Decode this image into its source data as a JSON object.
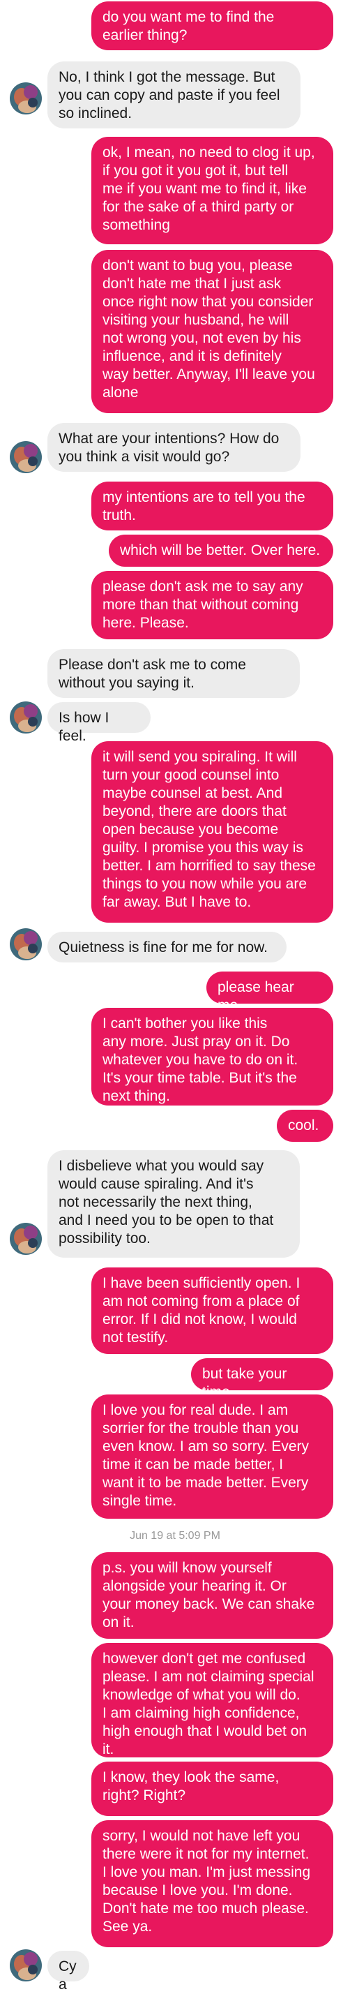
{
  "colors": {
    "sent_bubble": "#e8175d",
    "received_bubble": "#ececec",
    "timestamp_text": "#999999"
  },
  "messages": [
    {
      "text": "do you want me to find the\nearlier thing?"
    },
    {
      "text": "No, I think I got the message. But\nyou can copy and paste if you feel\nso inclined."
    },
    {
      "text": "ok, I mean, no need to clog it up,\nif you got it you got it, but tell\nme if you want me to find it, like\nfor the sake of a third party or\nsomething"
    },
    {
      "text": "don't want to bug you, please\ndon't hate me that I just ask\nonce right now that you consider\nvisiting your husband, he will\nnot wrong you, not even by his\ninfluence, and it is definitely\nway better. Anyway, I'll leave you\nalone"
    },
    {
      "text": "What are your intentions? How do\nyou think a visit would go?"
    },
    {
      "text": "my intentions are to tell you the\ntruth."
    },
    {
      "text": "which will be better. Over here."
    },
    {
      "text": "please don't ask me to say any\nmore than that without coming\nhere. Please."
    },
    {
      "text": "Please don't ask me to come\nwithout you saying it."
    },
    {
      "text": "Is how I feel."
    },
    {
      "text": "it will send you spiraling. It will\nturn your good counsel into\nmaybe counsel at best. And\nbeyond, there are doors that\nopen because you become\nguilty. I promise you this way is\nbetter. I am horrified to say these\nthings to you now while you are\nfar away. But I have to."
    },
    {
      "text": "Quietness is fine for me for now."
    },
    {
      "text": "please hear me."
    },
    {
      "text": "I can't bother you like this\nany more. Just pray on it. Do\nwhatever you have to do on it.\nIt's your time table. But it's the\nnext thing."
    },
    {
      "text": "cool."
    },
    {
      "text": "I disbelieve what you would say\nwould cause spiraling. And it's\nnot necessarily the next thing,\nand I need you to be open to that\npossibility too."
    },
    {
      "text": "I have been sufficiently open. I\nam not coming from a place of\nerror. If I did not know, I would\nnot testify."
    },
    {
      "text": "but take your time."
    },
    {
      "text": "I love you for real dude. I am\nsorrier for the trouble than you\neven know. I am so sorry. Every\ntime it can be made better, I\nwant it to be made better. Every\nsingle time."
    },
    {
      "text": "p.s. you will know yourself\nalongside your hearing it. Or\nyour money back. We can shake\non it."
    },
    {
      "text": "however don't get me confused\nplease. I am not claiming special\nknowledge of what you will do.\nI am claiming high confidence,\nhigh enough that I would bet on\nit."
    },
    {
      "text": "I know, they look the same,\nright? Right?"
    },
    {
      "text": "sorry, I would not have left you\nthere were it not for my internet.\nI love you man. I'm just messing\nbecause I love you. I'm done.\nDon't hate me too much please.\nSee ya."
    },
    {
      "text": "Cya"
    }
  ],
  "timestamp": "Jun 19 at 5:09 PM"
}
